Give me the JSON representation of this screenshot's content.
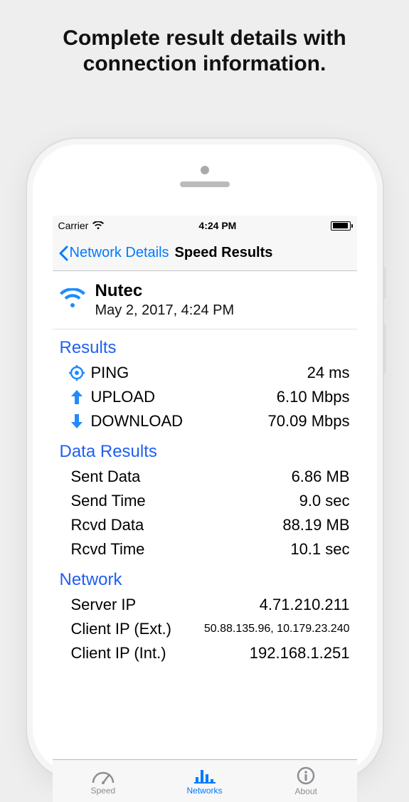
{
  "promo": {
    "line1": "Complete result details with",
    "line2": "connection information."
  },
  "status_bar": {
    "carrier": "Carrier",
    "time": "4:24 PM"
  },
  "nav": {
    "back_label": "Network Details",
    "title": "Speed Results"
  },
  "network_header": {
    "name": "Nutec",
    "timestamp": "May 2, 2017, 4:24 PM"
  },
  "sections": {
    "results_title": "Results",
    "data_results_title": "Data Results",
    "network_title": "Network"
  },
  "results": {
    "ping_label": "PING",
    "ping_value": "24 ms",
    "upload_label": "UPLOAD",
    "upload_value": "6.10 Mbps",
    "download_label": "DOWNLOAD",
    "download_value": "70.09 Mbps"
  },
  "data_results": {
    "sent_data_label": "Sent Data",
    "sent_data_value": "6.86 MB",
    "send_time_label": "Send Time",
    "send_time_value": "9.0 sec",
    "rcvd_data_label": "Rcvd Data",
    "rcvd_data_value": "88.19 MB",
    "rcvd_time_label": "Rcvd Time",
    "rcvd_time_value": "10.1 sec"
  },
  "network": {
    "server_ip_label": "Server IP",
    "server_ip_value": "4.71.210.211",
    "client_ip_ext_label": "Client IP (Ext.)",
    "client_ip_ext_value": "50.88.135.96, 10.179.23.240",
    "client_ip_int_label": "Client IP (Int.)",
    "client_ip_int_value": "192.168.1.251"
  },
  "tabs": {
    "speed": "Speed",
    "networks": "Networks",
    "about": "About"
  }
}
